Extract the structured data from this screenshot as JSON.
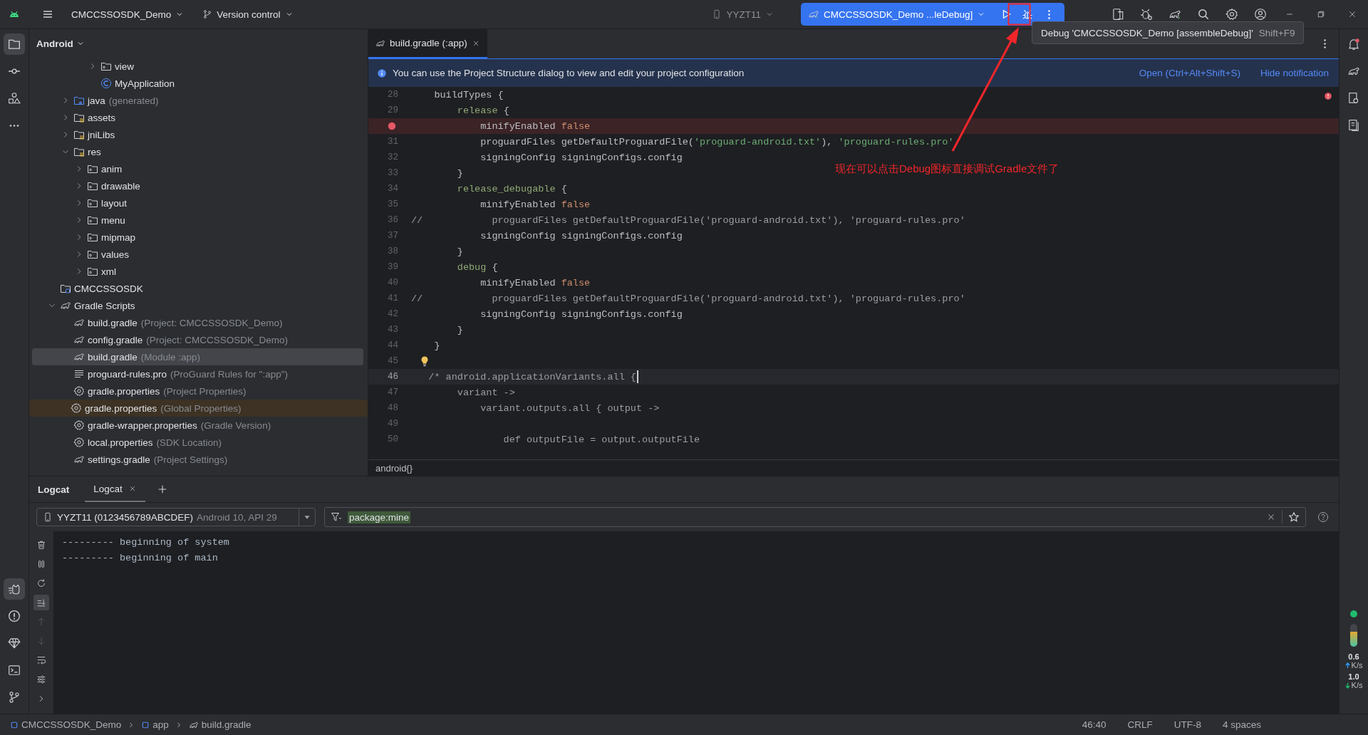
{
  "top_bar": {
    "project": "CMCCSSOSDK_Demo",
    "vcs": "Version control",
    "device": "YYZT11",
    "run_config": "CMCCSSOSDK_Demo ...leDebug]"
  },
  "tooltip": {
    "text": "Debug 'CMCCSSOSDK_Demo [assembleDebug]'",
    "shortcut": "Shift+F9"
  },
  "annotation": {
    "text": "现在可以点击Debug图标直接调试Gradle文件了"
  },
  "project_panel": {
    "view": "Android",
    "tree": {
      "rows_above": [
        {
          "name": "view",
          "kind": "folder",
          "expanded": false,
          "selected": false
        },
        {
          "name": "MyApplication",
          "kind": "class",
          "selected": false
        }
      ],
      "module_rows": [
        {
          "name": "java",
          "detail": "(generated)",
          "kind": "src-folder",
          "expanded": false,
          "selected": false
        },
        {
          "name": "assets",
          "kind": "res-folder",
          "expanded": false,
          "selected": false
        },
        {
          "name": "jniLibs",
          "kind": "res-folder",
          "expanded": false,
          "selected": false
        },
        {
          "name": "res",
          "kind": "res-folder",
          "expanded": true,
          "selected": false,
          "children": [
            {
              "name": "anim",
              "kind": "folder",
              "expanded": false,
              "selected": false
            },
            {
              "name": "drawable",
              "kind": "folder",
              "expanded": false,
              "selected": false
            },
            {
              "name": "layout",
              "kind": "folder",
              "expanded": false,
              "selected": false
            },
            {
              "name": "menu",
              "kind": "folder",
              "expanded": false,
              "selected": false
            },
            {
              "name": "mipmap",
              "kind": "folder",
              "expanded": false,
              "selected": false
            },
            {
              "name": "values",
              "kind": "folder",
              "expanded": false,
              "selected": false
            },
            {
              "name": "xml",
              "kind": "folder",
              "expanded": false,
              "selected": false
            }
          ]
        }
      ],
      "items": [
        {
          "name": "CMCCSSOSDK",
          "kind": "module",
          "selected": false
        },
        {
          "name": "Gradle Scripts",
          "kind": "gradle",
          "expanded": true,
          "selected": false,
          "children": [
            {
              "name": "build.gradle",
              "detail": "(Project: CMCCSSOSDK_Demo)",
              "kind": "gradle",
              "selected": false
            },
            {
              "name": "config.gradle",
              "detail": "(Project: CMCCSSOSDK_Demo)",
              "kind": "gradle",
              "selected": false
            },
            {
              "name": "build.gradle",
              "detail": "(Module :app)",
              "kind": "gradle",
              "selected": true
            },
            {
              "name": "proguard-rules.pro",
              "detail": "(ProGuard Rules for \":app\")",
              "kind": "text",
              "selected": false
            },
            {
              "name": "gradle.properties",
              "detail": "(Project Properties)",
              "kind": "settings",
              "selected": false
            },
            {
              "name": "gradle.properties",
              "detail": "(Global Properties)",
              "kind": "settings",
              "selected": false,
              "highlighted": true
            },
            {
              "name": "gradle-wrapper.properties",
              "detail": "(Gradle Version)",
              "kind": "settings",
              "selected": false
            },
            {
              "name": "local.properties",
              "detail": "(SDK Location)",
              "kind": "settings",
              "selected": false
            },
            {
              "name": "settings.gradle",
              "detail": "(Project Settings)",
              "kind": "gradle",
              "selected": false
            }
          ]
        }
      ]
    }
  },
  "editor": {
    "tabs": [
      {
        "label": "build.gradle (:app)",
        "selected": true
      }
    ],
    "notification": {
      "text": "You can use the Project Structure dialog to view and edit your project configuration",
      "actions": [
        "Open (Ctrl+Alt+Shift+S)",
        "Hide notification"
      ]
    },
    "lines": [
      {
        "number": "28",
        "kind": "normal",
        "tokens": [
          {
            "kind": "plain",
            "text": "    buildTypes {"
          }
        ]
      },
      {
        "number": "29",
        "kind": "normal",
        "tokens": [
          {
            "kind": "block",
            "text": "        release"
          },
          {
            "kind": "plain",
            "text": " {"
          }
        ]
      },
      {
        "kind": "breakpoint",
        "tokens": [
          {
            "kind": "plain",
            "text": "            minifyEnabled "
          },
          {
            "kind": "keyword",
            "text": "false"
          }
        ]
      },
      {
        "number": "31",
        "kind": "normal",
        "tokens": [
          {
            "kind": "plain",
            "text": "            proguardFiles getDefaultProguardFile("
          },
          {
            "kind": "string",
            "text": "'proguard-android.txt'"
          },
          {
            "kind": "plain",
            "text": "), "
          },
          {
            "kind": "string",
            "text": "'proguard-rules.pro'"
          }
        ]
      },
      {
        "number": "32",
        "kind": "normal",
        "tokens": [
          {
            "kind": "plain",
            "text": "            signingConfig signingConfigs.config"
          }
        ]
      },
      {
        "number": "33",
        "kind": "normal",
        "tokens": [
          {
            "kind": "plain",
            "text": "        }"
          }
        ]
      },
      {
        "number": "34",
        "kind": "normal",
        "tokens": [
          {
            "kind": "block",
            "text": "        release_debugable"
          },
          {
            "kind": "plain",
            "text": " {"
          }
        ]
      },
      {
        "number": "35",
        "kind": "normal",
        "tokens": [
          {
            "kind": "plain",
            "text": "            minifyEnabled "
          },
          {
            "kind": "keyword",
            "text": "false"
          }
        ]
      },
      {
        "number": "36",
        "kind": "normal",
        "tokens": [
          {
            "kind": "comment",
            "text": "//            proguardFiles getDefaultProguardFile('proguard-android.txt'), 'proguard-rules.pro'"
          }
        ]
      },
      {
        "number": "37",
        "kind": "normal",
        "tokens": [
          {
            "kind": "plain",
            "text": "            signingConfig signingConfigs.config"
          }
        ]
      },
      {
        "number": "38",
        "kind": "normal",
        "tokens": [
          {
            "kind": "plain",
            "text": "        }"
          }
        ]
      },
      {
        "number": "39",
        "kind": "normal",
        "tokens": [
          {
            "kind": "block",
            "text": "        debug"
          },
          {
            "kind": "plain",
            "text": " {"
          }
        ]
      },
      {
        "number": "40",
        "kind": "normal",
        "tokens": [
          {
            "kind": "plain",
            "text": "            minifyEnabled "
          },
          {
            "kind": "keyword",
            "text": "false"
          }
        ]
      },
      {
        "number": "41",
        "kind": "normal",
        "tokens": [
          {
            "kind": "comment",
            "text": "//            proguardFiles getDefaultProguardFile('proguard-android.txt'), 'proguard-rules.pro'"
          }
        ]
      },
      {
        "number": "42",
        "kind": "normal",
        "tokens": [
          {
            "kind": "plain",
            "text": "            signingConfig signingConfigs.config"
          }
        ]
      },
      {
        "number": "43",
        "kind": "normal",
        "tokens": [
          {
            "kind": "plain",
            "text": "        }"
          }
        ]
      },
      {
        "number": "44",
        "kind": "normal",
        "tokens": [
          {
            "kind": "plain",
            "text": "    }"
          }
        ]
      },
      {
        "number": "45",
        "kind": "hint"
      },
      {
        "number": "46",
        "kind": "current",
        "tokens": [
          {
            "kind": "comment",
            "text": "   /* android.applicationVariants.all {"
          }
        ]
      },
      {
        "number": "47",
        "kind": "normal",
        "tokens": [
          {
            "kind": "comment",
            "text": "        variant ->"
          }
        ]
      },
      {
        "number": "48",
        "kind": "normal",
        "tokens": [
          {
            "kind": "comment",
            "text": "            variant.outputs.all { output ->"
          }
        ]
      },
      {
        "number": "49",
        "kind": "normal"
      },
      {
        "number": "50",
        "kind": "normal",
        "tokens": [
          {
            "kind": "comment",
            "text": "                def outputFile = output.outputFile"
          }
        ]
      }
    ],
    "breadcrumb": "android{}"
  },
  "bottom_panel": {
    "title": "Logcat",
    "tabs": [
      {
        "label": "Logcat",
        "selected": true
      }
    ],
    "device": {
      "name": "YYZT11 (0123456789ABCDEF)",
      "detail": "Android 10, API 29"
    },
    "filter": {
      "value": "package:mine"
    },
    "log_lines": [
      "--------- beginning of system",
      "--------- beginning of main"
    ]
  },
  "status_bar": {
    "path": [
      {
        "label": "CMCCSSOSDK_Demo",
        "kind": "module"
      },
      {
        "label": "app",
        "kind": "module"
      },
      {
        "label": "build.gradle",
        "kind": "gradle"
      }
    ],
    "items": [
      "46:40",
      "CRLF",
      "UTF-8",
      "4 spaces"
    ]
  },
  "side_meters": {
    "memory": {
      "level": 0.65
    },
    "upload": {
      "value": "0.6",
      "unit": "K/s"
    },
    "download": {
      "value": "1.0",
      "unit": "K/s"
    }
  }
}
